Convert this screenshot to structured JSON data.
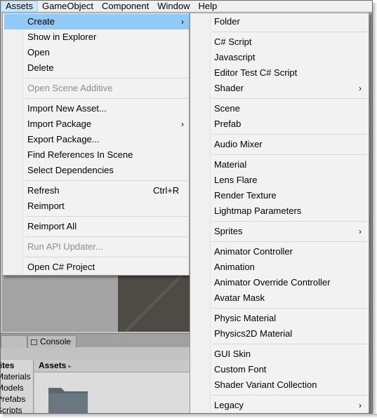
{
  "menubar": {
    "items": [
      "Assets",
      "GameObject",
      "Component",
      "Window",
      "Help"
    ],
    "active_index": 0
  },
  "editor": {
    "console_tab": "Console",
    "assets_header": "Assets",
    "assets_arrow": "▸",
    "project_tree": [
      "rites",
      "Materials",
      "Models",
      "Prefabs",
      "Scripts"
    ]
  },
  "assets_menu": {
    "items": [
      {
        "label": "Create",
        "submenu": true,
        "highlighted": true
      },
      {
        "label": "Show in Explorer"
      },
      {
        "label": "Open"
      },
      {
        "label": "Delete"
      },
      {
        "label": "Open Scene Additive",
        "disabled": true
      },
      {
        "label": "Import New Asset..."
      },
      {
        "label": "Import Package",
        "submenu": true
      },
      {
        "label": "Export Package..."
      },
      {
        "label": "Find References In Scene"
      },
      {
        "label": "Select Dependencies"
      },
      {
        "label": "Refresh",
        "shortcut": "Ctrl+R"
      },
      {
        "label": "Reimport"
      },
      {
        "label": "Reimport All"
      },
      {
        "label": "Run API Updater...",
        "disabled": true
      },
      {
        "label": "Open C# Project"
      }
    ]
  },
  "create_menu": {
    "items": [
      {
        "label": "Folder"
      },
      {
        "label": "C# Script"
      },
      {
        "label": "Javascript"
      },
      {
        "label": "Editor Test C# Script"
      },
      {
        "label": "Shader",
        "submenu": true
      },
      {
        "label": "Scene"
      },
      {
        "label": "Prefab"
      },
      {
        "label": "Audio Mixer"
      },
      {
        "label": "Material"
      },
      {
        "label": "Lens Flare"
      },
      {
        "label": "Render Texture"
      },
      {
        "label": "Lightmap Parameters"
      },
      {
        "label": "Sprites",
        "submenu": true
      },
      {
        "label": "Animator Controller"
      },
      {
        "label": "Animation"
      },
      {
        "label": "Animator Override Controller"
      },
      {
        "label": "Avatar Mask"
      },
      {
        "label": "Physic Material"
      },
      {
        "label": "Physics2D Material"
      },
      {
        "label": "GUI Skin"
      },
      {
        "label": "Custom Font"
      },
      {
        "label": "Shader Variant Collection"
      },
      {
        "label": "Legacy",
        "submenu": true
      }
    ]
  },
  "glyphs": {
    "submenu_arrow": "›"
  },
  "colors": {
    "highlight": "#91c9f7",
    "menubar_active": "#cce8ff",
    "disabled_text": "#8d8d8d"
  }
}
